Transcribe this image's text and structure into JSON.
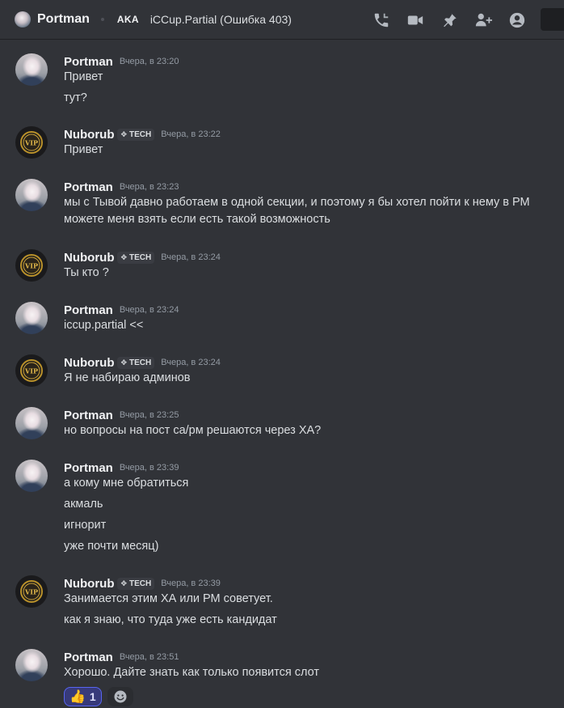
{
  "header": {
    "name": "Portman",
    "aka": "AKA",
    "nickname": "iCCup.Partial (Ошибка 403)",
    "icons": [
      "phone-icon",
      "video-icon",
      "pin-icon",
      "add-friend-icon",
      "profile-icon"
    ]
  },
  "messages": [
    {
      "author": "Portman",
      "time": "Вчера, в 23:20",
      "lines": [
        "Привет",
        "тут?"
      ]
    },
    {
      "author": "Nuborub",
      "tag": "TECH",
      "time": "Вчера, в 23:22",
      "lines": [
        "Привет"
      ]
    },
    {
      "author": "Portman",
      "time": "Вчера, в 23:23",
      "lines": [
        "мы с Тывой давно работаем в одной секции, и поэтому я бы хотел пойти к нему в РМ",
        "можете меня взять если есть такой возможность"
      ]
    },
    {
      "author": "Nuborub",
      "tag": "TECH",
      "time": "Вчера, в 23:24",
      "lines": [
        "Ты кто ?"
      ]
    },
    {
      "author": "Portman",
      "time": "Вчера, в 23:24",
      "lines": [
        "iccup.partial <<"
      ]
    },
    {
      "author": "Nuborub",
      "tag": "TECH",
      "time": "Вчера, в 23:24",
      "lines": [
        "Я не набираю админов"
      ]
    },
    {
      "author": "Portman",
      "time": "Вчера, в 23:25",
      "lines": [
        "но вопросы на пост са/рм решаются через ХА?"
      ]
    },
    {
      "author": "Portman",
      "time": "Вчера, в 23:39",
      "lines": [
        "а кому мне обратиться",
        "акмаль",
        "игнорит",
        "уже почти месяц)"
      ]
    },
    {
      "author": "Nuborub",
      "tag": "TECH",
      "time": "Вчера, в 23:39",
      "lines": [
        "Занимается этим ХА или РМ советует.",
        "как я знаю, что туда уже есть кандидат"
      ]
    },
    {
      "author": "Portman",
      "time": "Вчера, в 23:51",
      "lines": [
        "Хорошо. Дайте знать как только появится слот"
      ]
    }
  ],
  "reaction": {
    "emoji": "👍",
    "count": "1"
  },
  "colors": {
    "background": "#313338",
    "accent": "#5865f2",
    "muted": "#949ba4"
  }
}
